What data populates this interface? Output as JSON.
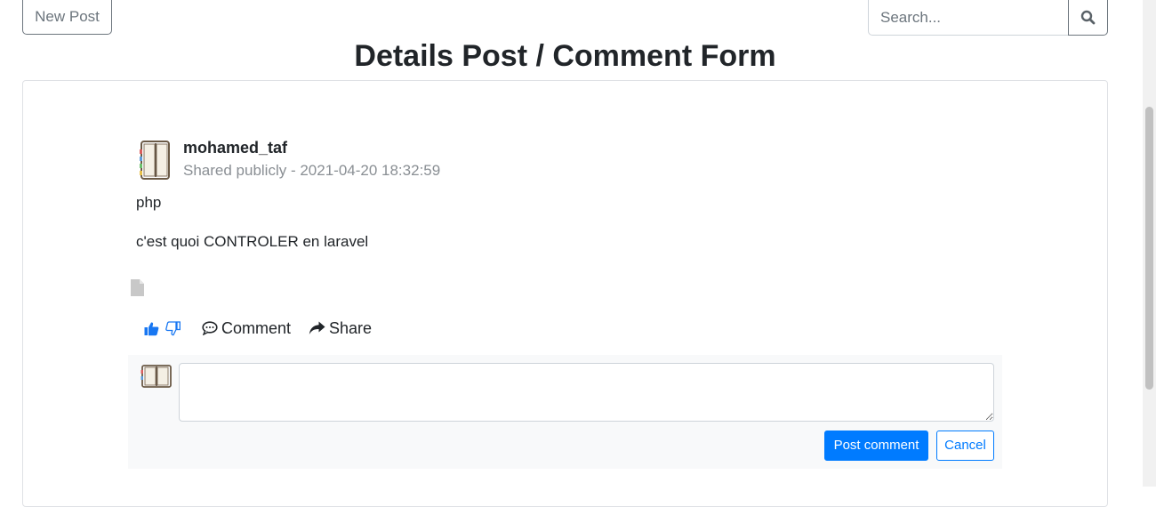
{
  "header": {
    "new_post_label": "New Post",
    "search_placeholder": "Search...",
    "search_icon": "search-icon"
  },
  "page_title": "Details Post / Comment Form",
  "post": {
    "author": "mohamed_taf",
    "meta": "Shared publicly - 2021-04-20 18:32:59",
    "title": "php",
    "body": "c'est quoi CONTROLER en laravel",
    "attachment_icon": "file-icon"
  },
  "actions": {
    "like_icon": "thumbs-up-icon",
    "dislike_icon": "thumbs-down-icon",
    "comment_label": "Comment",
    "share_label": "Share"
  },
  "comment_form": {
    "textarea_value": "",
    "post_label": "Post comment",
    "cancel_label": "Cancel"
  },
  "colors": {
    "primary": "#007bff",
    "muted": "#6c757d",
    "panel_bg": "#f8f9fa"
  }
}
